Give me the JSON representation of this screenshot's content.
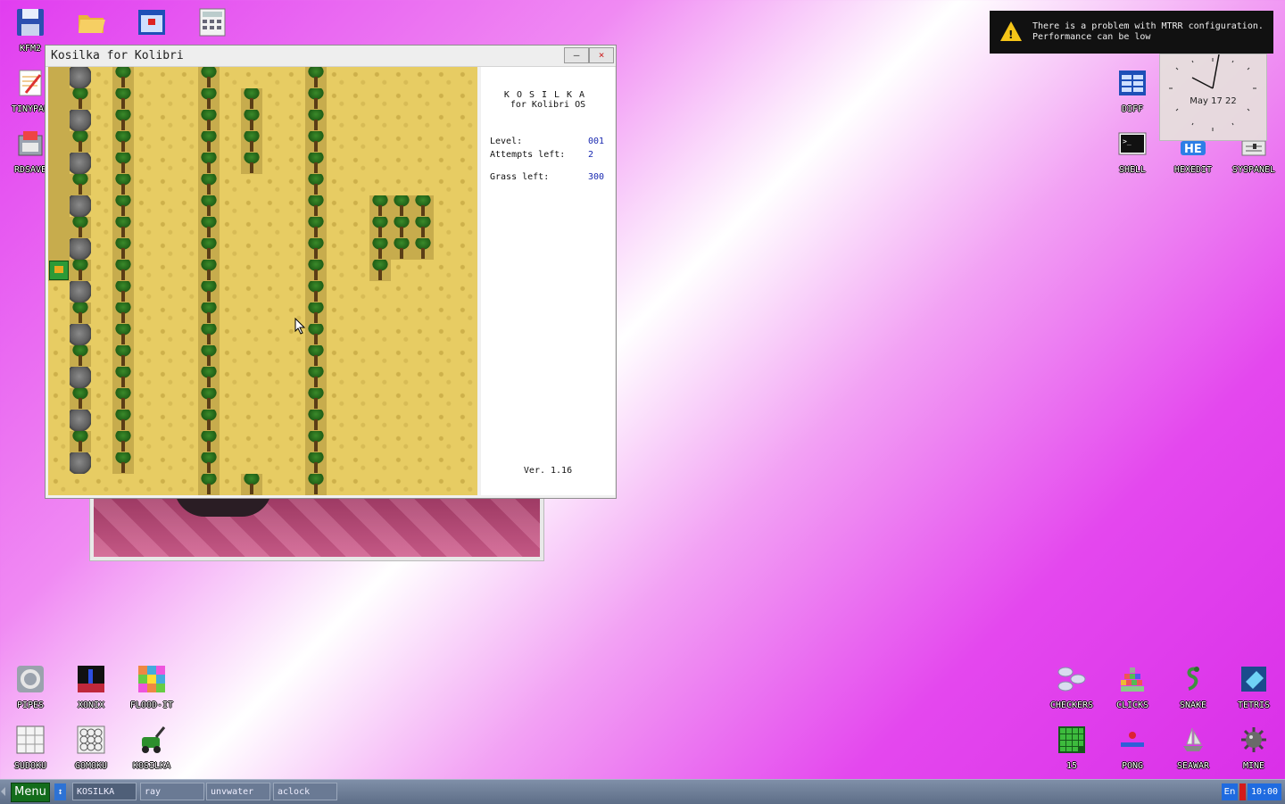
{
  "desktop": {
    "icons_top_left": [
      {
        "label": "KFM2",
        "icon": "floppy-icon"
      },
      {
        "label": "",
        "icon": "folder-icon"
      },
      {
        "label": "",
        "icon": "calendar-icon"
      },
      {
        "label": "",
        "icon": "calculator-icon"
      },
      {
        "label": "TINYPAD",
        "icon": "notepad-icon"
      },
      {
        "label": "RDSAVE",
        "icon": "rdsave-icon"
      }
    ],
    "icons_top_right": [
      {
        "label": "DIFF",
        "icon": "diff-icon"
      },
      {
        "label": "SHELL",
        "icon": "shell-icon"
      },
      {
        "label": "HEXEDIT",
        "icon": "hexedit-icon"
      },
      {
        "label": "SYSPANEL",
        "icon": "syspanel-icon"
      }
    ],
    "icons_bottom_left": [
      {
        "label": "PIPES",
        "icon": "pipes-icon"
      },
      {
        "label": "XONIX",
        "icon": "xonix-icon"
      },
      {
        "label": "FLOOD-IT",
        "icon": "flood-it-icon"
      },
      {
        "label": "SUDOKU",
        "icon": "sudoku-icon"
      },
      {
        "label": "GOMOKU",
        "icon": "gomoku-icon"
      },
      {
        "label": "KOSILKA",
        "icon": "lawnmower-icon"
      }
    ],
    "icons_bottom_right": [
      {
        "label": "CHECKERS",
        "icon": "checkers-icon"
      },
      {
        "label": "CLICKS",
        "icon": "clicks-icon"
      },
      {
        "label": "SNAKE",
        "icon": "snake-icon"
      },
      {
        "label": "TETRIS",
        "icon": "tetris-icon"
      },
      {
        "label": "15",
        "icon": "fifteen-icon"
      },
      {
        "label": "PONG",
        "icon": "pong-icon"
      },
      {
        "label": "SEAWAR",
        "icon": "seawar-icon"
      },
      {
        "label": "MINE",
        "icon": "mine-icon"
      }
    ]
  },
  "notification": {
    "icon": "warning-icon",
    "message": "There is a problem with MTRR configuration.\nPerformance can be low"
  },
  "clock_widget": {
    "date": "May 17 22"
  },
  "kosilka_window": {
    "title": "Kosilka for Kolibri",
    "minimize_label": "–",
    "close_label": "×",
    "info": {
      "heading": "KOSILKA",
      "subheading": "for Kolibri OS",
      "level_label": "Level:",
      "level_value": "001",
      "attempts_label": "Attempts left:",
      "attempts_value": "2",
      "grass_label": "Grass left:",
      "grass_value": "300",
      "version": "Ver. 1.16"
    }
  },
  "taskbar": {
    "menu_label": "Menu",
    "swap_label": "↕",
    "tasks": [
      "KOSILKA",
      "ray",
      "unvwater",
      "aclock"
    ],
    "language": "En",
    "time": "10:00"
  }
}
